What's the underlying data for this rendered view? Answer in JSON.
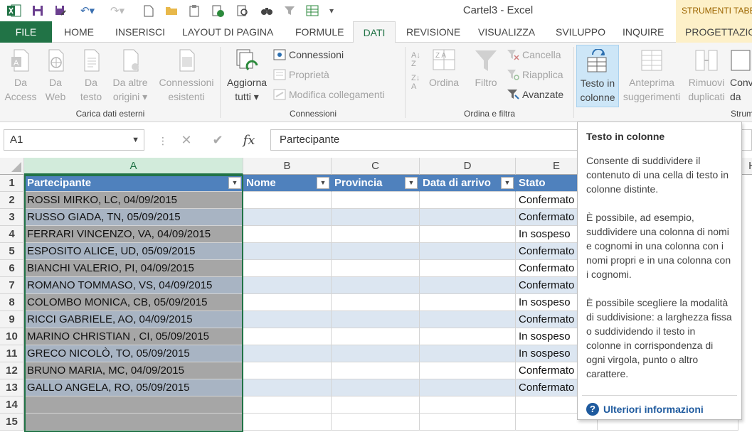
{
  "window": {
    "title": "Cartel3 - Excel",
    "context_header": "STRUMENTI TABE"
  },
  "tabs": [
    "FILE",
    "HOME",
    "INSERISCI",
    "LAYOUT DI PAGINA",
    "FORMULE",
    "DATI",
    "REVISIONE",
    "VISUALIZZA",
    "SVILUPPO",
    "INQUIRE",
    "PROGETTAZIO"
  ],
  "ribbon": {
    "ext": {
      "access": [
        "Da",
        "Access"
      ],
      "web": [
        "Da",
        "Web"
      ],
      "text": [
        "Da",
        "testo"
      ],
      "other": [
        "Da altre",
        "origini ▾"
      ],
      "existing": [
        "Connessioni",
        "esistenti"
      ],
      "label": "Carica dati esterni"
    },
    "conn": {
      "refresh": [
        "Aggiorna",
        "tutti ▾"
      ],
      "connections": "Connessioni",
      "properties": "Proprietà",
      "edit_links": "Modifica collegamenti",
      "label": "Connessioni"
    },
    "sort": {
      "sort": "Ordina",
      "filter": "Filtro",
      "clear": "Cancella",
      "reapply": "Riapplica",
      "advanced": "Avanzate",
      "label": "Ordina e filtra"
    },
    "tools": {
      "text_to_cols": [
        "Testo in",
        "colonne"
      ],
      "flash": [
        "Anteprima",
        "suggerimenti"
      ],
      "dups": [
        "Rimuovi",
        "duplicati"
      ],
      "conv": [
        "Conv",
        "da"
      ],
      "label": "Strum"
    }
  },
  "formula_bar": {
    "name_box": "A1",
    "fx": "fx",
    "content": "Partecipante"
  },
  "grid": {
    "columns": [
      "A",
      "B",
      "C",
      "D",
      "E",
      "H"
    ],
    "headers": [
      "Partecipante",
      "Nome",
      "Provincia",
      "Data di arrivo",
      "Stato"
    ],
    "rows": [
      {
        "n": "2",
        "a": "ROSSI MIRKO, LC, 04/09/2015",
        "e": "Confermato"
      },
      {
        "n": "3",
        "a": "RUSSO GIADA, TN, 05/09/2015",
        "e": "Confermato"
      },
      {
        "n": "4",
        "a": "FERRARI VINCENZO, VA, 04/09/2015",
        "e": "In sospeso"
      },
      {
        "n": "5",
        "a": "ESPOSITO ALICE, UD, 05/09/2015",
        "e": "Confermato"
      },
      {
        "n": "6",
        "a": "BIANCHI VALERIO, PI, 04/09/2015",
        "e": "Confermato"
      },
      {
        "n": "7",
        "a": "ROMANO TOMMASO, VS, 04/09/2015",
        "e": "Confermato"
      },
      {
        "n": "8",
        "a": "COLOMBO MONICA, CB, 05/09/2015",
        "e": "In sospeso"
      },
      {
        "n": "9",
        "a": "RICCI GABRIELE, AO, 04/09/2015",
        "e": "Confermato"
      },
      {
        "n": "10",
        "a": "MARINO CHRISTIAN , CI, 05/09/2015",
        "e": "In sospeso"
      },
      {
        "n": "11",
        "a": "GRECO NICOLÒ, TO, 05/09/2015",
        "e": "In sospeso"
      },
      {
        "n": "12",
        "a": "BRUNO MARIA, MC, 04/09/2015",
        "e": "Confermato"
      },
      {
        "n": "13",
        "a": "GALLO ANGELA, RO, 05/09/2015",
        "e": "Confermato"
      },
      {
        "n": "14",
        "a": "",
        "e": ""
      },
      {
        "n": "15",
        "a": "",
        "e": ""
      }
    ],
    "first_row_number": "1"
  },
  "tooltip": {
    "title": "Testo in colonne",
    "p1": "Consente di suddividere il contenuto di una cella di testo in colonne distinte.",
    "p2": "È possibile, ad esempio, suddividere una colonna di nomi e cognomi in una colonna con i nomi propri e in una colonna con i cognomi.",
    "p3": "È possibile scegliere la modalità di suddivisione: a larghezza fissa o suddividendo il testo in colonne in corrispondenza di ogni virgola, punto o altro carattere.",
    "more": "Ulteriori informazioni"
  },
  "colors": {
    "excel_green": "#217346",
    "table_header": "#4f81bd",
    "band": "#dce6f1"
  }
}
